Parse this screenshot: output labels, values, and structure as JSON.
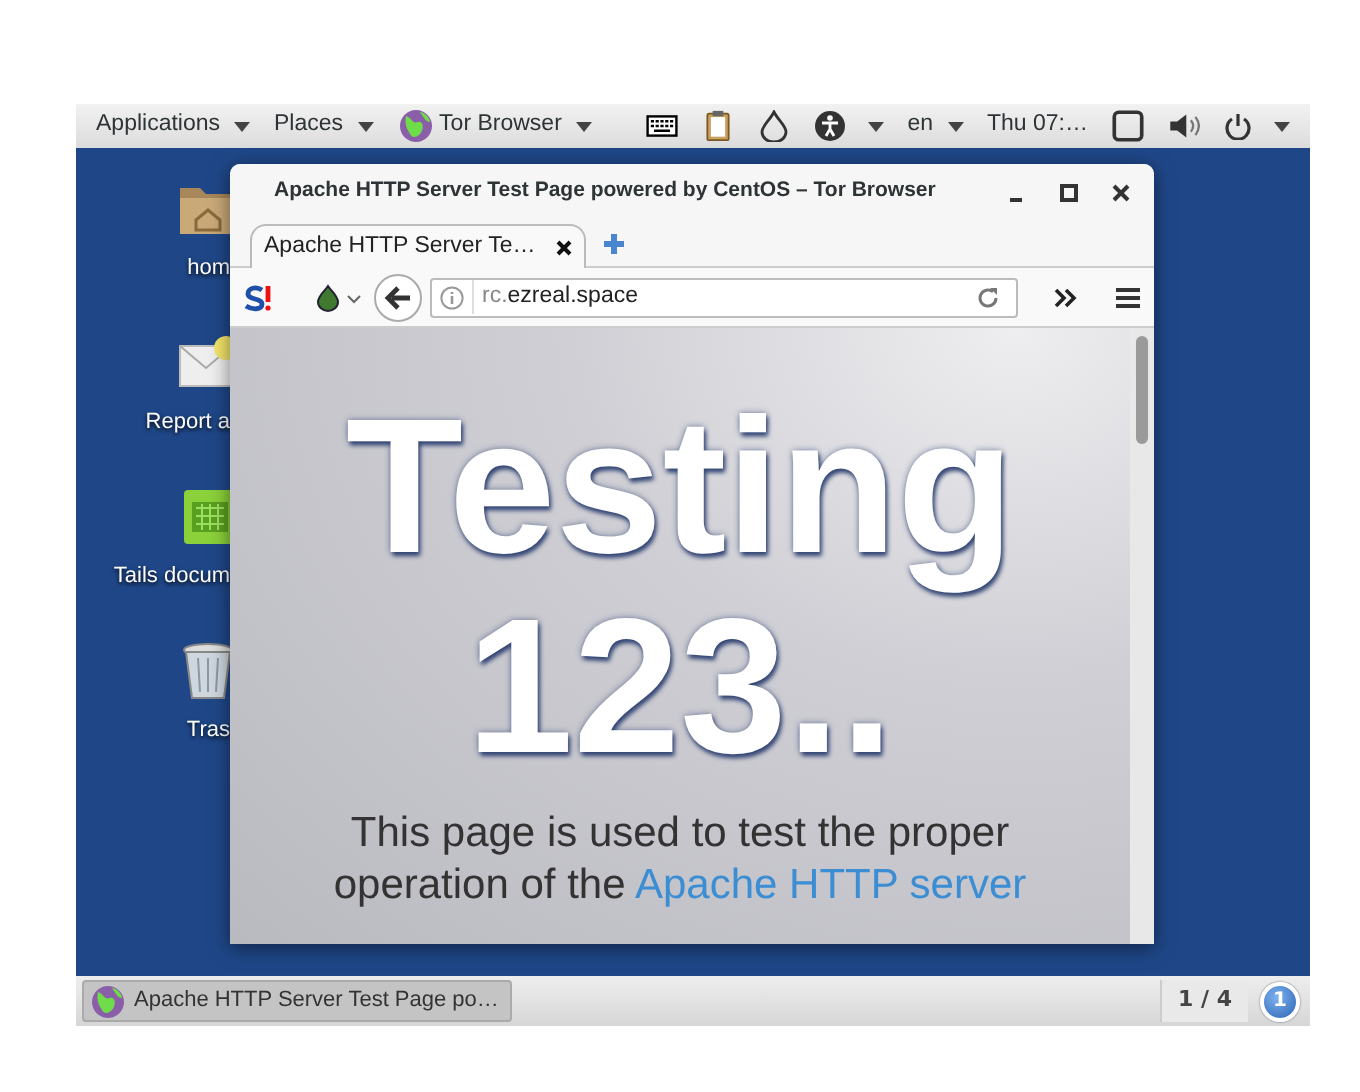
{
  "top_bar": {
    "menus": [
      {
        "label": "Applications",
        "kind": "text"
      },
      {
        "label": "Places",
        "kind": "text"
      },
      {
        "label": "Tor Browser",
        "kind": "app"
      }
    ],
    "keyboard_layout": "en",
    "clock": "Thu 07:…"
  },
  "desktop_icons": [
    {
      "label": "hom",
      "kind": "folder"
    },
    {
      "label": "Report a",
      "kind": "mail"
    },
    {
      "label": "Tails docum",
      "kind": "book"
    },
    {
      "label": "Tras",
      "kind": "trash"
    }
  ],
  "window": {
    "title": "Apache HTTP Server Test Page powered by CentOS – Tor Browser",
    "tabs": [
      {
        "label": "Apache HTTP Server Te…",
        "selected": true
      }
    ],
    "url_prefix": "rc.",
    "url_domain": "ezreal.space",
    "page": {
      "heading_line_1": "Testing",
      "heading_line_2": "123..",
      "paragraph_line_1": "This page is used to test the proper",
      "paragraph_line_2": "operation of the ",
      "link": "Apache HTTP server"
    }
  },
  "taskbar": {
    "tasks": [
      {
        "label": "Apache HTTP Server Test Page po…",
        "selected": true
      }
    ],
    "workspace": "1 / 4",
    "notification_count": "1"
  }
}
